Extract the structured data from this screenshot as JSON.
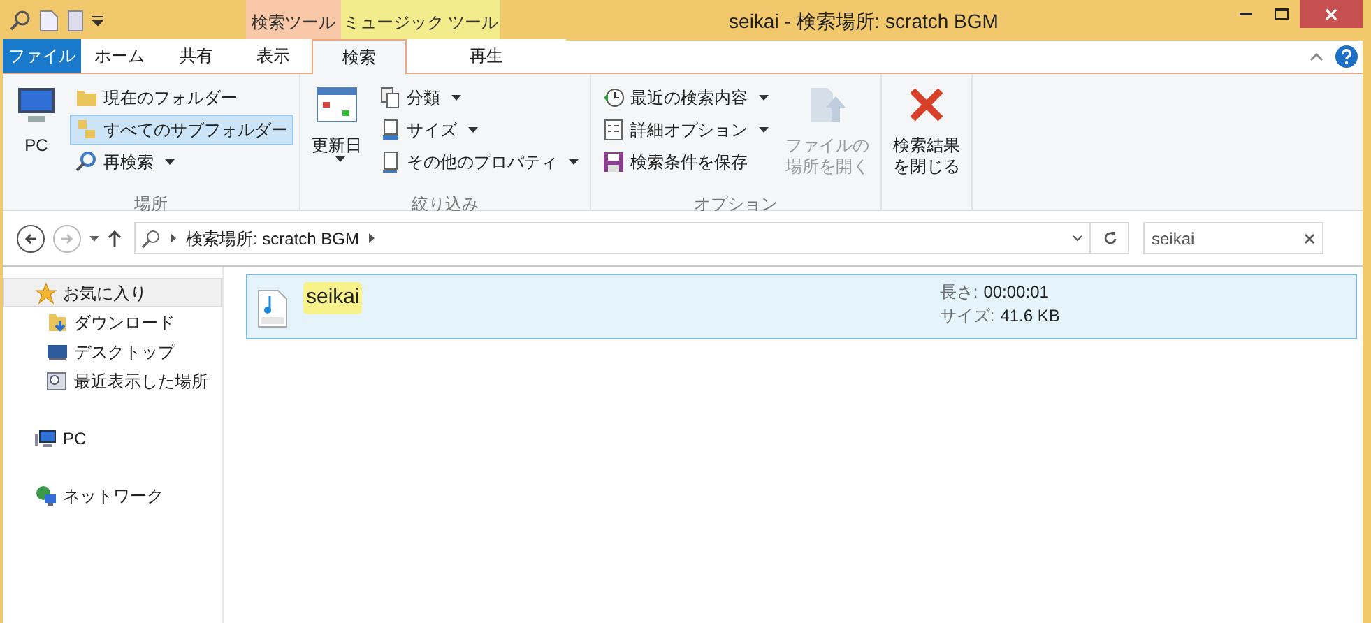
{
  "window": {
    "title": "seikai - 検索場所: scratch BGM"
  },
  "ribbon": {
    "context_groups": [
      {
        "label": "検索ツール",
        "color": "#f9c8a8"
      },
      {
        "label": "ミュージック ツール",
        "color": "#f2ec8c"
      }
    ],
    "tabs": [
      {
        "label": "ファイル",
        "kind": "file",
        "selected": false
      },
      {
        "label": "ホーム",
        "kind": "normal",
        "selected": false
      },
      {
        "label": "共有",
        "kind": "normal",
        "selected": false
      },
      {
        "label": "表示",
        "kind": "normal",
        "selected": false
      },
      {
        "label": "検索",
        "kind": "context",
        "selected": true
      },
      {
        "label": "再生",
        "kind": "context",
        "selected": false
      }
    ],
    "groups": [
      {
        "label": "場所",
        "items": [
          {
            "kind": "large",
            "label": [
              "PC"
            ],
            "dropdown": false,
            "disabled": false
          },
          {
            "kind": "small",
            "label": "現在のフォルダー",
            "dropdown": false,
            "selected": false
          },
          {
            "kind": "small",
            "label": "すべてのサブフォルダー",
            "dropdown": false,
            "selected": true
          },
          {
            "kind": "small",
            "label": "再検索",
            "dropdown": true,
            "selected": false
          }
        ]
      },
      {
        "label": "絞り込み",
        "items": [
          {
            "kind": "large",
            "label": [
              "更新日"
            ],
            "dropdown": true,
            "disabled": false
          },
          {
            "kind": "small",
            "label": "分類",
            "dropdown": true,
            "selected": false
          },
          {
            "kind": "small",
            "label": "サイズ",
            "dropdown": true,
            "selected": false
          },
          {
            "kind": "small",
            "label": "その他のプロパティ",
            "dropdown": true,
            "selected": false
          }
        ]
      },
      {
        "label": "オプション",
        "items": [
          {
            "kind": "small",
            "label": "最近の検索内容",
            "dropdown": true,
            "selected": false
          },
          {
            "kind": "small",
            "label": "詳細オプション",
            "dropdown": true,
            "selected": false
          },
          {
            "kind": "small",
            "label": "検索条件を保存",
            "dropdown": false,
            "selected": false
          },
          {
            "kind": "large",
            "label": [
              "ファイルの",
              "場所を開く"
            ],
            "dropdown": false,
            "disabled": true
          }
        ]
      },
      {
        "items": [
          {
            "kind": "large",
            "label": [
              "検索結果",
              "を閉じる"
            ],
            "dropdown": false,
            "disabled": false
          }
        ]
      }
    ]
  },
  "address_bar": {
    "path": "検索場所: scratch BGM"
  },
  "search": {
    "value": "seikai"
  },
  "sidebar": {
    "items": [
      {
        "label": "お気に入り",
        "selected": true,
        "children": [
          {
            "label": "ダウンロード",
            "selected": false
          },
          {
            "label": "デスクトップ",
            "selected": false
          },
          {
            "label": "最近表示した場所",
            "selected": false
          }
        ]
      },
      {
        "label": "PC",
        "selected": false
      },
      {
        "label": "ネットワーク",
        "selected": false
      }
    ]
  },
  "results": [
    {
      "name": "seikai",
      "selected": true,
      "details": [
        {
          "label": "長さ:",
          "value": "00:00:01"
        },
        {
          "label": "サイズ:",
          "value": "41.6 KB"
        }
      ]
    }
  ]
}
